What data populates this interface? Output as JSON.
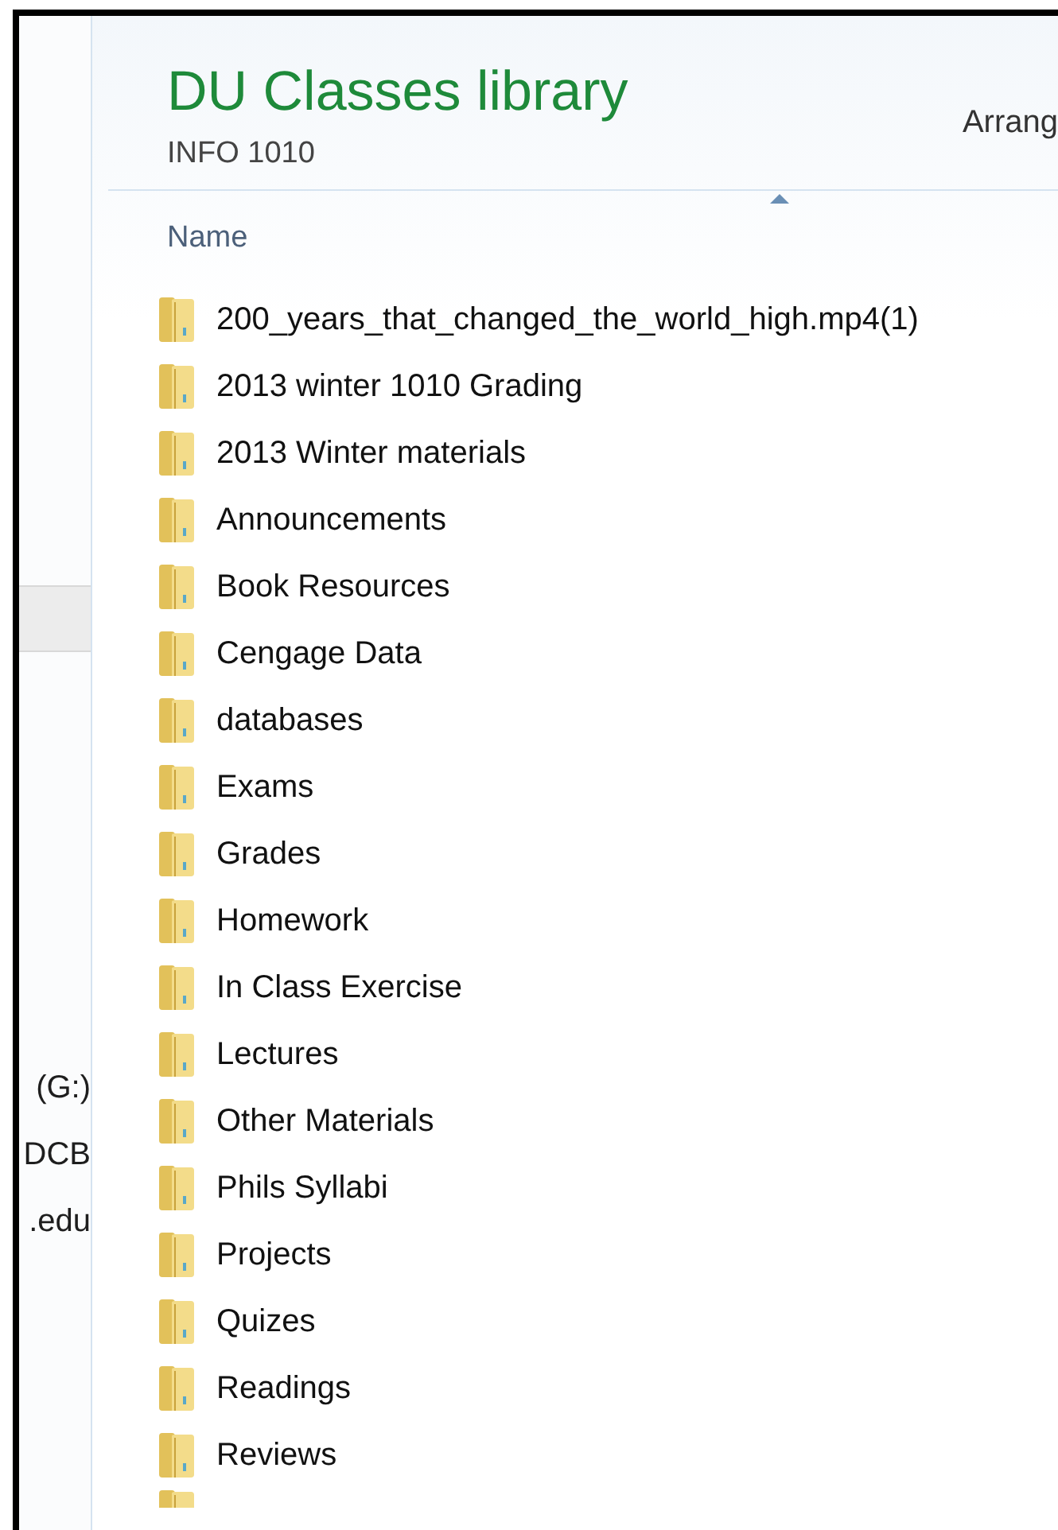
{
  "nav_pane": {
    "items": [
      "(G:)",
      "DCB",
      ".edu"
    ]
  },
  "library": {
    "title": "DU Classes library",
    "subtitle": "INFO 1010",
    "arrange_label": "Arrang"
  },
  "columns": [
    {
      "label": "Name",
      "sorted": true
    }
  ],
  "folders": [
    "200_years_that_changed_the_world_high.mp4(1)",
    "2013 winter 1010 Grading",
    "2013 Winter materials",
    "Announcements",
    "Book Resources",
    "Cengage Data",
    "databases",
    "Exams",
    "Grades",
    "Homework",
    "In Class Exercise",
    "Lectures",
    "Other Materials",
    "Phils Syllabi",
    "Projects",
    "Quizes",
    "Readings",
    "Reviews"
  ]
}
